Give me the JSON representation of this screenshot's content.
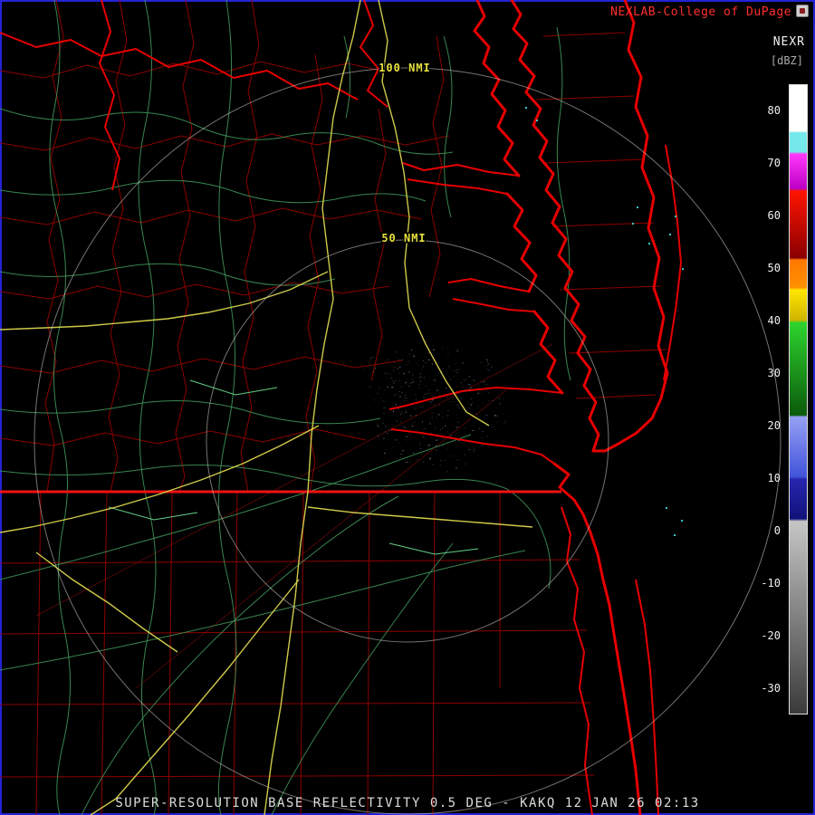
{
  "header": {
    "attribution": "NEXLAB-College of DuPage",
    "product_label": "NEXR",
    "units_label": "[dBZ]"
  },
  "map": {
    "radar_site": "KAKQ",
    "range_ring_50_label": "50 NMI",
    "range_ring_100_label": "100 NMI"
  },
  "caption": "SUPER-RESOLUTION BASE REFLECTIVITY 0.5 DEG - KAKQ 12 JAN 26 02:13",
  "colorbar": {
    "ticks": [
      "80",
      "70",
      "60",
      "50",
      "40",
      "30",
      "20",
      "10",
      "0",
      "-10",
      "-20",
      "-30"
    ],
    "stops": [
      {
        "pos": 0.0,
        "color": "#ffffff"
      },
      {
        "pos": 0.073,
        "color": "#ffffff"
      },
      {
        "pos": 0.076,
        "color": "#74e8ea"
      },
      {
        "pos": 0.106,
        "color": "#74e8ea"
      },
      {
        "pos": 0.11,
        "color": "#ff38fa"
      },
      {
        "pos": 0.165,
        "color": "#bc00c4"
      },
      {
        "pos": 0.168,
        "color": "#ff1400"
      },
      {
        "pos": 0.275,
        "color": "#8a0000"
      },
      {
        "pos": 0.278,
        "color": "#ff7800"
      },
      {
        "pos": 0.322,
        "color": "#ff9000"
      },
      {
        "pos": 0.326,
        "color": "#ffe600"
      },
      {
        "pos": 0.374,
        "color": "#ceb400"
      },
      {
        "pos": 0.378,
        "color": "#2ed42e"
      },
      {
        "pos": 0.525,
        "color": "#0b5a0b"
      },
      {
        "pos": 0.528,
        "color": "#96a0f4"
      },
      {
        "pos": 0.623,
        "color": "#4254da"
      },
      {
        "pos": 0.627,
        "color": "#2626b0"
      },
      {
        "pos": 0.69,
        "color": "#12127a"
      },
      {
        "pos": 0.694,
        "color": "#c6c6c6"
      },
      {
        "pos": 1.0,
        "color": "#3a3a3a"
      }
    ]
  },
  "colors": {
    "coastline": "#e60000",
    "county_lines": "#930000",
    "roads": "#3f9459",
    "highways": "#d9d44c",
    "range_rings": "#d8d2c8",
    "attribution_text": "#ff2e2e",
    "caption_text": "#dcdcdc",
    "ocean_specks": "#41e8e6",
    "echo_speckle": "#808ca8"
  }
}
